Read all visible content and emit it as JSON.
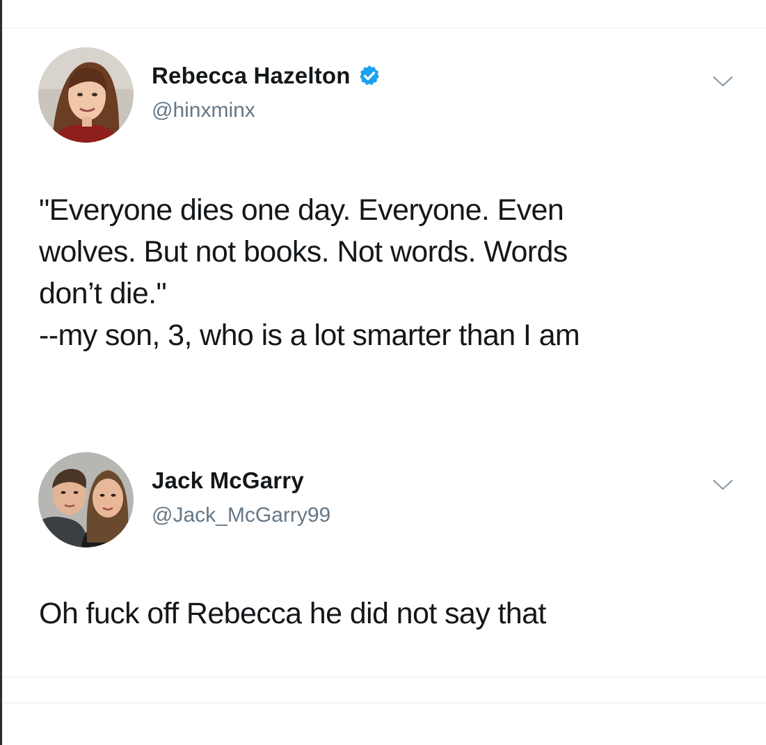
{
  "tweets": [
    {
      "display_name": "Rebecca Hazelton",
      "handle": "@hinxminx",
      "verified": true,
      "avatar_icon": "avatar-portrait-woman",
      "menu_icon": "chevron-down-icon",
      "text_lines": [
        "\"Everyone dies one day. Everyone. Even",
        "wolves. But not books. Not words. Words",
        "don’t die.\"",
        "--my son, 3, who is a lot smarter than I am"
      ]
    },
    {
      "display_name": "Jack McGarry",
      "handle": "@Jack_McGarry99",
      "verified": false,
      "avatar_icon": "avatar-portrait-couple",
      "menu_icon": "chevron-down-icon",
      "text_lines": [
        "Oh fuck off Rebecca he did not say that"
      ]
    }
  ],
  "colors": {
    "text": "#14171a",
    "handle": "#657786",
    "verified_badge": "#1da1f2",
    "divider": "#e6ecf0",
    "chevron": "#8899a6"
  }
}
